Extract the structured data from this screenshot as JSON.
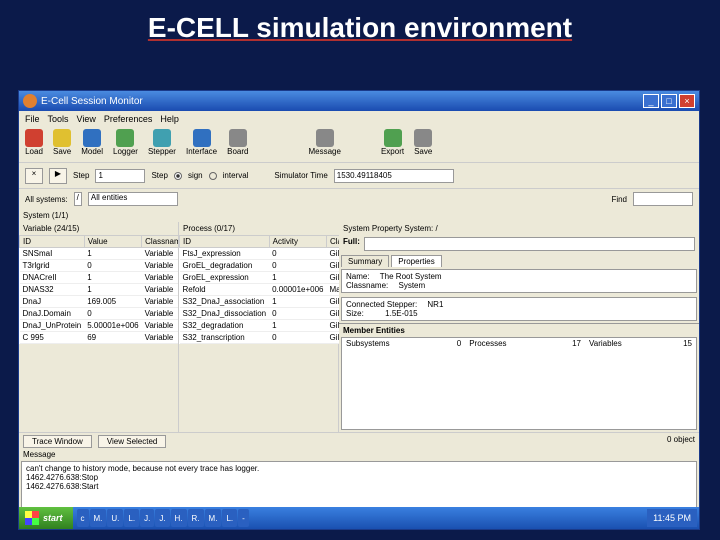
{
  "slide": {
    "title": "E-CELL simulation environment"
  },
  "window": {
    "title": "E-Cell Session Monitor"
  },
  "menubar": [
    "File",
    "Tools",
    "View",
    "Preferences",
    "Help"
  ],
  "toolbar": [
    {
      "label": "Load",
      "color": "ti-red"
    },
    {
      "label": "Save",
      "color": "ti-yellow"
    },
    {
      "label": "Model",
      "color": "ti-blue"
    },
    {
      "label": "Logger",
      "color": "ti-green"
    },
    {
      "label": "Stepper",
      "color": "ti-cyan"
    },
    {
      "label": "Interface",
      "color": "ti-blue"
    },
    {
      "label": "Board",
      "color": "ti-grey"
    },
    {
      "label": "Message",
      "color": "ti-grey"
    },
    {
      "label": "Export",
      "color": "ti-green"
    },
    {
      "label": "Save",
      "color": "ti-grey"
    }
  ],
  "controls": {
    "step_label": "Step",
    "step_val": "1",
    "mode_sign": "sign",
    "mode_interval": "interval",
    "simtime_label": "Simulator Time",
    "simtime_value": "1530.49118405"
  },
  "selectors": {
    "system_label": "All systems:",
    "system_value": "/",
    "entity_value": "All entities",
    "find_label": "Find",
    "find_value": ""
  },
  "system_list": {
    "header": "System (1/1)"
  },
  "variable_list": {
    "header": "Variable (24/15)",
    "columns": [
      "ID",
      "Value",
      "Classname"
    ],
    "rows": [
      [
        "SNSmaI",
        "1",
        "Variable"
      ],
      [
        "T3rlgrid",
        "0",
        "Variable"
      ],
      [
        "DNACreII",
        "1",
        "Variable"
      ],
      [
        "DNAS32",
        "1",
        "Variable"
      ],
      [
        "DnaJ",
        "169.005",
        "Variable"
      ],
      [
        "DnaJ.Domain",
        "0",
        "Variable"
      ],
      [
        "DnaJ_UnProtein",
        "5.00001e+006",
        "Variable"
      ],
      [
        "C 995",
        "69",
        "Variable"
      ]
    ]
  },
  "process_list": {
    "header": "Process (0/17)",
    "columns": [
      "ID",
      "Activity",
      "Class"
    ],
    "rows": [
      [
        "FtsJ_expression",
        "0",
        "Gillesp"
      ],
      [
        "GroEL_degradation",
        "0",
        "Gillesp"
      ],
      [
        "GroEL_expression",
        "1",
        "Gillesp"
      ],
      [
        "Refold",
        "0.00001e+006",
        "Mass"
      ],
      [
        "S32_DnaJ_association",
        "1",
        "Gillesp"
      ],
      [
        "S32_DnaJ_dissociation",
        "0",
        "Gillesp"
      ],
      [
        "S32_degradation",
        "1",
        "Gillesp"
      ],
      [
        "S32_transcription",
        "0",
        "Gillesp"
      ]
    ]
  },
  "property": {
    "system_label": "System Property",
    "system_value": "System: /",
    "full_label": "Full:",
    "tabs": [
      "Summary",
      "Properties"
    ],
    "name_label": "Name:",
    "name_value": "The Root System",
    "classname_label": "Classname:",
    "classname_value": "System",
    "stepper_label": "Connected Stepper:",
    "stepper_value": "NR1",
    "size_label": "Size:",
    "size_value": "1.5E-015",
    "member_header": "Member Entities",
    "member_columns": [
      "Subsystems",
      "Processes",
      "Variables"
    ],
    "member_values": [
      "0",
      "17",
      "15"
    ]
  },
  "bottom": {
    "trace_btn": "Trace Window",
    "view_btn": "View Selected",
    "message_label": "Message",
    "count": "0 object",
    "lines": [
      "can't change to history mode, because not every trace has logger.",
      "1462.4276.638:Stop",
      "1462.4276.638:Start"
    ]
  },
  "taskbar": {
    "start": "start",
    "items": [
      "c",
      "M.",
      "U.",
      "L.",
      "J.",
      "J.",
      "H.",
      "R.",
      "M.",
      "L.",
      "-"
    ],
    "time": "11:45 PM"
  }
}
